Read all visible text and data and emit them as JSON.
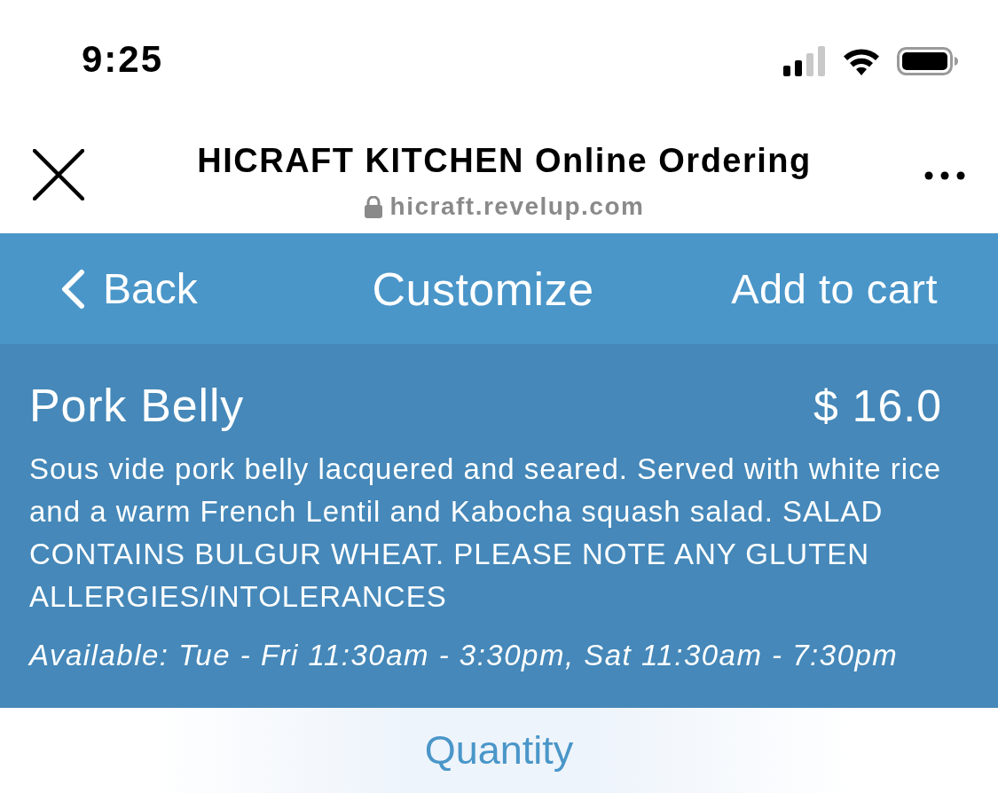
{
  "status_bar": {
    "time": "9:25"
  },
  "browser": {
    "title": "HICRAFT KITCHEN Online Ordering",
    "url": "hicraft.revelup.com"
  },
  "nav": {
    "back": "Back",
    "title": "Customize",
    "action": "Add to cart"
  },
  "item": {
    "name": "Pork Belly",
    "price": "$ 16.0",
    "description": "Sous vide pork belly lacquered and seared. Served with white rice and a warm French Lentil and Kabocha squash salad. SALAD CONTAINS BULGUR WHEAT. PLEASE NOTE ANY GLUTEN ALLERGIES/INTOLERANCES",
    "availability": "Available: Tue - Fri 11:30am - 3:30pm, Sat 11:30am - 7:30pm"
  },
  "section": {
    "title": "Quantity"
  }
}
